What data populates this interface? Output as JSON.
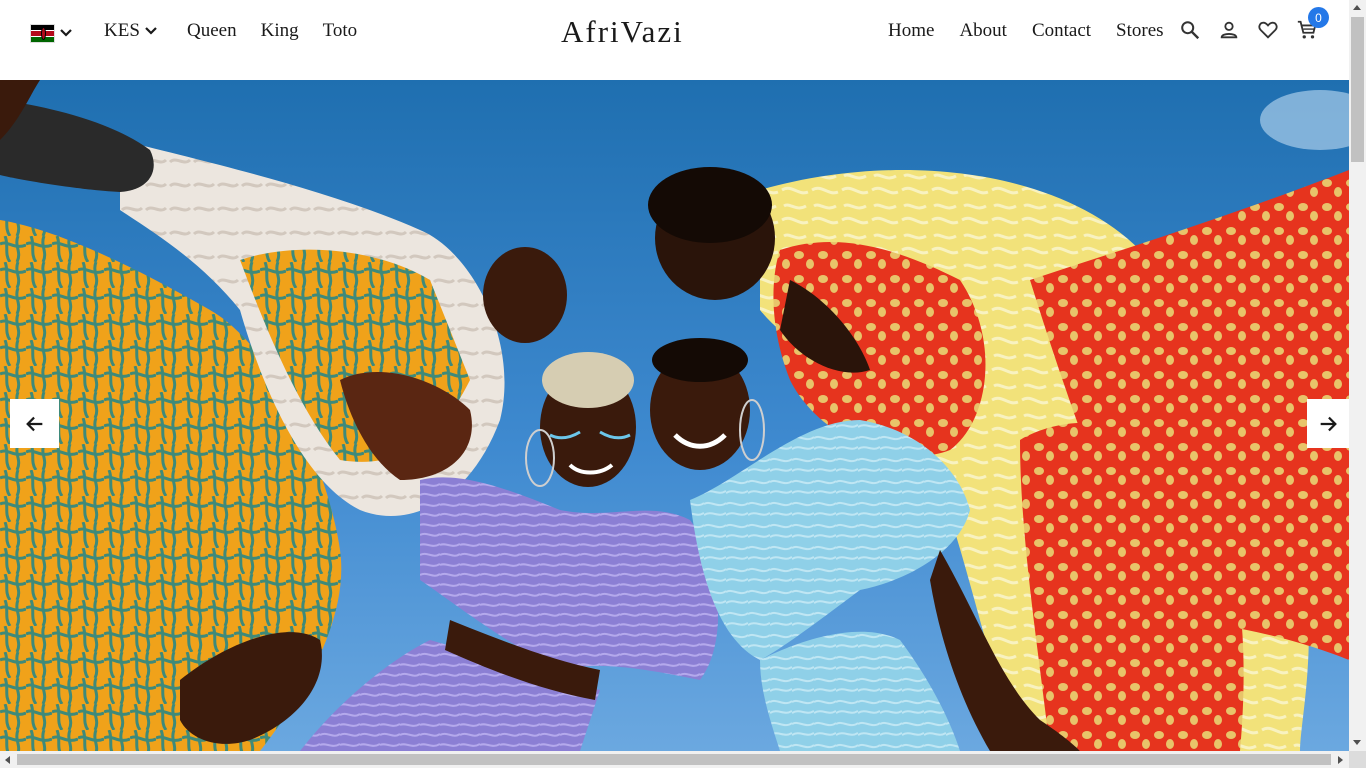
{
  "header": {
    "country_flag": "kenya-flag-icon",
    "currency": "KES",
    "nav_left": [
      "Queen",
      "King",
      "Toto"
    ],
    "logo": "AfriVazi",
    "nav_right": [
      "Home",
      "About",
      "Contact",
      "Stores"
    ],
    "cart_count": "0",
    "icons": [
      "search-icon",
      "account-icon",
      "wishlist-heart-icon",
      "cart-icon"
    ]
  },
  "hero": {
    "image": "fashion-models-group-photo",
    "prev_icon": "arrow-left-icon",
    "next_icon": "arrow-right-icon"
  },
  "colors": {
    "badge": "#2478e8",
    "sky": "#3f8ad0",
    "text": "#1a1a1a"
  }
}
